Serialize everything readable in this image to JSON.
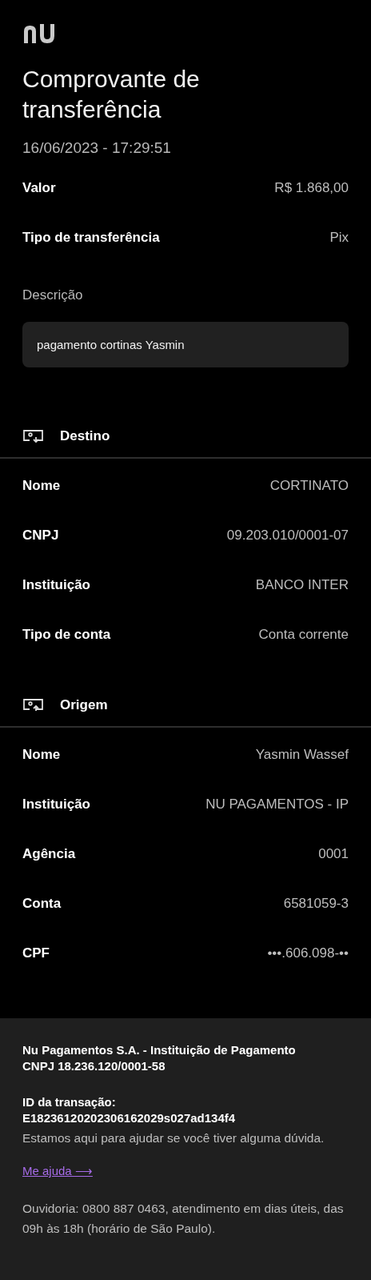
{
  "header": {
    "title": "Comprovante de transferência",
    "datetime": "16/06/2023 - 17:29:51"
  },
  "summary": [
    {
      "label": "Valor",
      "value": "R$ 1.868,00"
    },
    {
      "label": "Tipo de transferência",
      "value": "Pix"
    }
  ],
  "description": {
    "label": "Descrição",
    "text": "pagamento cortinas Yasmin"
  },
  "sections": [
    {
      "kind": "destination",
      "title": "Destino",
      "rows": [
        {
          "label": "Nome",
          "value": "CORTINATO"
        },
        {
          "label": "CNPJ",
          "value": "09.203.010/0001-07"
        },
        {
          "label": "Instituição",
          "value": "BANCO INTER"
        },
        {
          "label": "Tipo de conta",
          "value": "Conta corrente"
        }
      ]
    },
    {
      "kind": "origin",
      "title": "Origem",
      "rows": [
        {
          "label": "Nome",
          "value": "Yasmin Wassef"
        },
        {
          "label": "Instituição",
          "value": "NU PAGAMENTOS - IP"
        },
        {
          "label": "Agência",
          "value": "0001"
        },
        {
          "label": "Conta",
          "value": "6581059-3"
        },
        {
          "label": "CPF",
          "value": "•••.606.098-••"
        }
      ]
    }
  ],
  "footer": {
    "company": "Nu Pagamentos S.A. - Instituição de Pagamento",
    "cnpj": "CNPJ 18.236.120/0001-58",
    "transaction_label": "ID da transação:",
    "transaction_id": "E18236120202306162029s027ad134f4",
    "help_text": "Estamos aqui para ajudar se você tiver alguma dúvida.",
    "help_link": "Me ajuda ⟶",
    "ombudsman": "Ouvidoria: 0800 887 0463, atendimento em dias úteis, das 09h às 18h (horário de São Paulo)."
  }
}
